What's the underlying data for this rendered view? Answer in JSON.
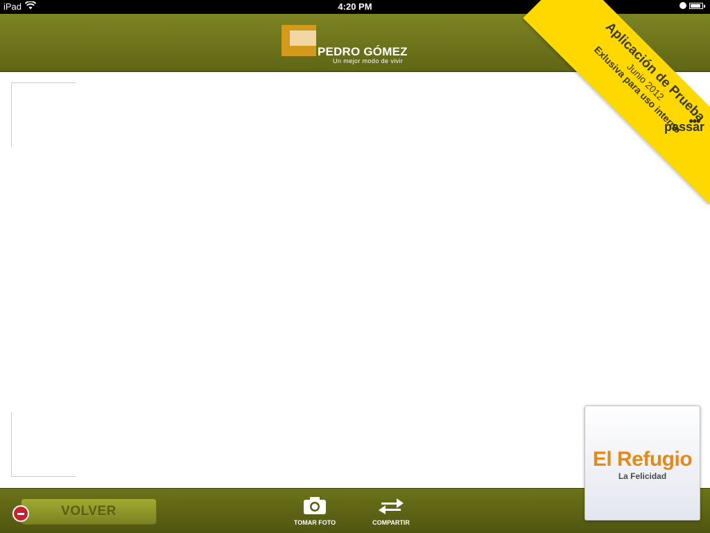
{
  "status_bar": {
    "device": "iPad",
    "time": "4:20 PM",
    "battery_level": 0.9
  },
  "header": {
    "brand_name": "PEDRO GÓMEZ",
    "tagline": "Un mejor modo de vivir",
    "background": "#6e751d"
  },
  "ribbon": {
    "title": "Aplicación de Prueba",
    "date": "Junio 2012",
    "note": "Exlusiva para uso interno",
    "brand": "passar",
    "color": "#ffd800"
  },
  "toolbar": {
    "back_label": "VOLVER",
    "take_photo_label": "TOMAR FOTO",
    "share_label": "COMPARTIR",
    "icons": [
      "delete-icon",
      "camera-icon",
      "share-arrows-icon"
    ]
  },
  "project_card": {
    "name": "El Refugio",
    "subtitle": "La Felicidad",
    "accent": "#e38a1a"
  }
}
